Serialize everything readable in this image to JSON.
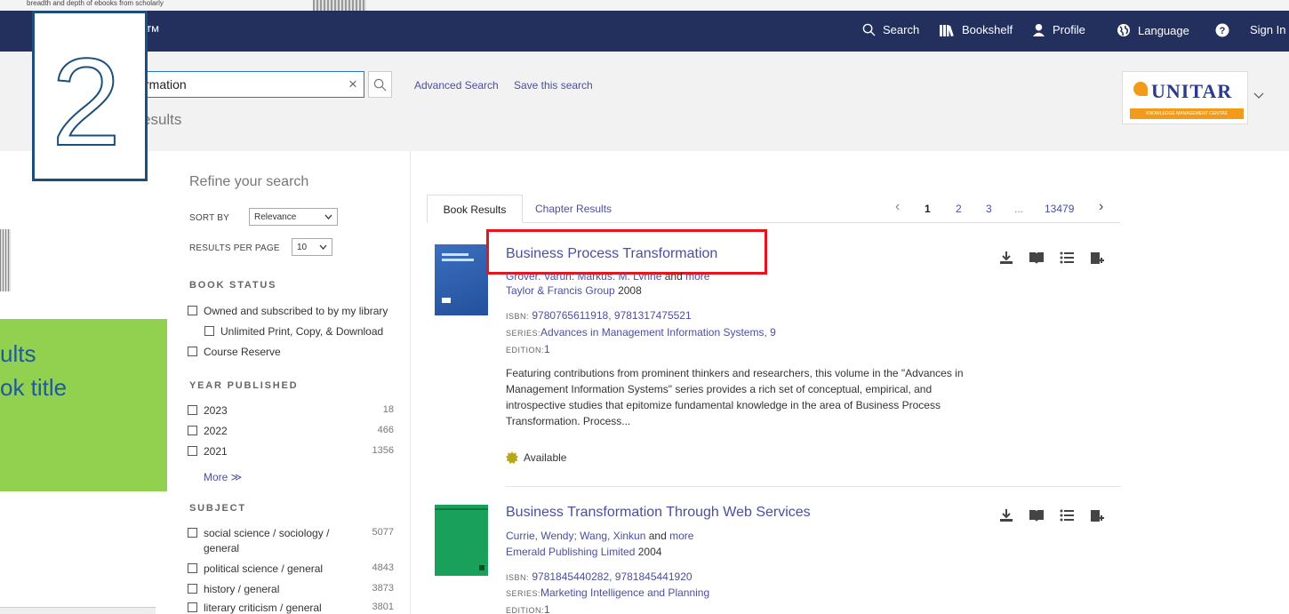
{
  "top_fragment": "breadth and depth of ebooks from scholarly",
  "nav": {
    "logo": "™",
    "search": "Search",
    "bookshelf": "Bookshelf",
    "profile": "Profile",
    "language": "Language",
    "sign_in": "Sign In"
  },
  "search": {
    "value": "rmation",
    "clear": "×",
    "advanced": "Advanced Search",
    "save": "Save this search",
    "results_label": "esults"
  },
  "brand": {
    "name": "UNITAR",
    "subtitle": "KNOWLEDGE MANAGEMENT CENTRE"
  },
  "overlay": {
    "step": "2",
    "callout_line1": "ults",
    "callout_line2": "ok title"
  },
  "sidebar": {
    "title": "Refine your search",
    "sort_by_label": "SORT BY",
    "sort_by_value": "Relevance",
    "per_page_label": "RESULTS PER PAGE",
    "per_page_value": "10",
    "book_status_heading": "BOOK STATUS",
    "status_items": [
      "Owned and subscribed to by my library",
      "Unlimited Print, Copy, & Download",
      "Course Reserve"
    ],
    "year_heading": "YEAR PUBLISHED",
    "years": [
      {
        "label": "2023",
        "count": "18"
      },
      {
        "label": "2022",
        "count": "466"
      },
      {
        "label": "2021",
        "count": "1356"
      }
    ],
    "more": "More ≫",
    "subject_heading": "SUBJECT",
    "subjects": [
      {
        "label": "social science / sociology /",
        "label2": "general",
        "count": "5077"
      },
      {
        "label": "political science / general",
        "count": "4843"
      },
      {
        "label": "history / general",
        "count": "3873"
      },
      {
        "label": "literary criticism / general",
        "count": "3801"
      }
    ]
  },
  "tabs": {
    "book_results": "Book Results",
    "chapter_results": "Chapter Results"
  },
  "pager": {
    "prev": "‹",
    "pages": [
      "1",
      "2",
      "3"
    ],
    "ellipsis": "...",
    "last": "13479",
    "next": "›"
  },
  "results": [
    {
      "title": "Business Process Transformation",
      "authors": "Grover, Varun; Markus, M. Lynne",
      "and": "and",
      "more": "more",
      "publisher": "Taylor & Francis Group",
      "year": "2008",
      "isbn_label": "ISBN:",
      "isbn": "9780765611918, 9781317475521",
      "series_label": "SERIES:",
      "series": "Advances in Management Information Systems, 9",
      "edition_label": "EDITION:",
      "edition": "1",
      "description": "Featuring contributions from prominent thinkers and researchers, this volume in the \"Advances in Management Information Systems\" series provides a rich set of conceptual, empirical, and introspective studies that epitomize fundamental knowledge in the area of Business Process Transformation. Process...",
      "availability": "Available",
      "cover_color": "#2f5fb0"
    },
    {
      "title": "Business Transformation Through Web Services",
      "authors": "Currie, Wendy; Wang, Xinkun",
      "and": "and",
      "more": "more",
      "publisher": "Emerald Publishing Limited",
      "year": "2004",
      "isbn_label": "ISBN:",
      "isbn": "9781845440282, 9781845441920",
      "series_label": "SERIES:",
      "series": "Marketing Intelligence and Planning",
      "edition_label": "EDITION:",
      "edition": "1",
      "cover_color": "#19a05a"
    }
  ],
  "colors": {
    "nav_bg": "#23305e",
    "link": "#4b4f9e",
    "highlight": "#e8141b",
    "callout_bg": "#92d050",
    "callout_text": "#1f5b9a"
  }
}
